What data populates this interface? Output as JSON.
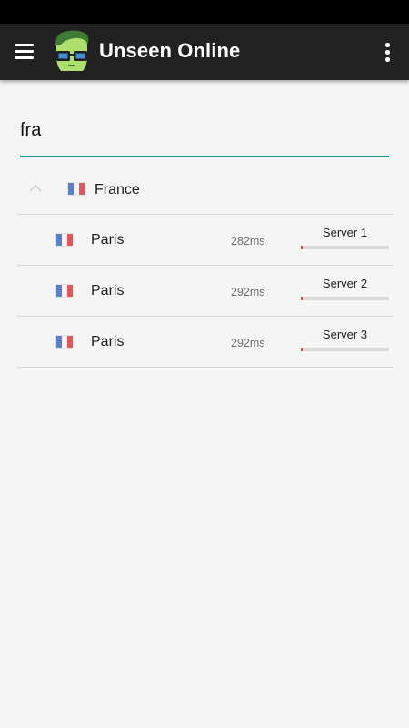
{
  "app_bar": {
    "title": "Unseen Online",
    "menu_icon": "hamburger-menu-icon",
    "logo_icon": "nerd-glasses-face-logo",
    "overflow_icon": "more-vertical-icon",
    "background": "#212121"
  },
  "search": {
    "value": "fra",
    "accent_color": "#1e9a88"
  },
  "country": {
    "name": "France",
    "expanded": true,
    "flag_icon": "france-flag-icon"
  },
  "servers": [
    {
      "city": "Paris",
      "ping": "282ms",
      "name": "Server 1",
      "load": 0.01
    },
    {
      "city": "Paris",
      "ping": "292ms",
      "name": "Server 2",
      "load": 0.01
    },
    {
      "city": "Paris",
      "ping": "292ms",
      "name": "Server 3",
      "load": 0.01
    }
  ],
  "colors": {
    "load_fill": "#e53935",
    "load_track": "#d9d9d9"
  }
}
